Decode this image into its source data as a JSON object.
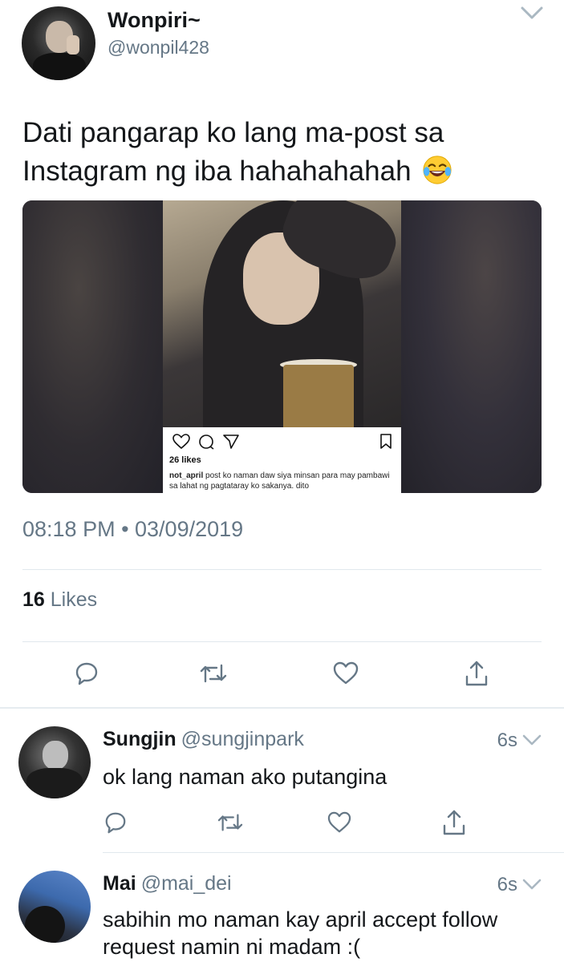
{
  "tweet": {
    "author": {
      "display_name": "Wonpiri~",
      "handle": "@wonpil428"
    },
    "text": "Dati pangarap ko lang ma-post sa Instagram ng iba hahahahahah",
    "emoji": "face-with-tears-of-joy",
    "embedded_instagram": {
      "likes": "26 likes",
      "caption_user": "not_april",
      "caption_text": "post ko naman daw siya minsan para may pambawi sa lahat ng pagtataray ko sakanya. dito"
    },
    "timestamp": "08:18 PM • 03/09/2019",
    "likes_count": "16",
    "likes_label": "Likes"
  },
  "actions": [
    "reply-icon",
    "retweet-icon",
    "like-icon",
    "share-icon"
  ],
  "replies": [
    {
      "name": "Sungjin",
      "handle": "@sungjinpark",
      "time": "6s",
      "text": "ok lang naman ako putangina"
    },
    {
      "name": "Mai",
      "handle": "@mai_dei",
      "time": "6s",
      "text": "sabihin mo naman kay april accept follow request namin ni madam :("
    }
  ],
  "colors": {
    "text": "#14171a",
    "secondary": "#657786",
    "divider": "#e1e8ed",
    "icon": "#657786"
  }
}
